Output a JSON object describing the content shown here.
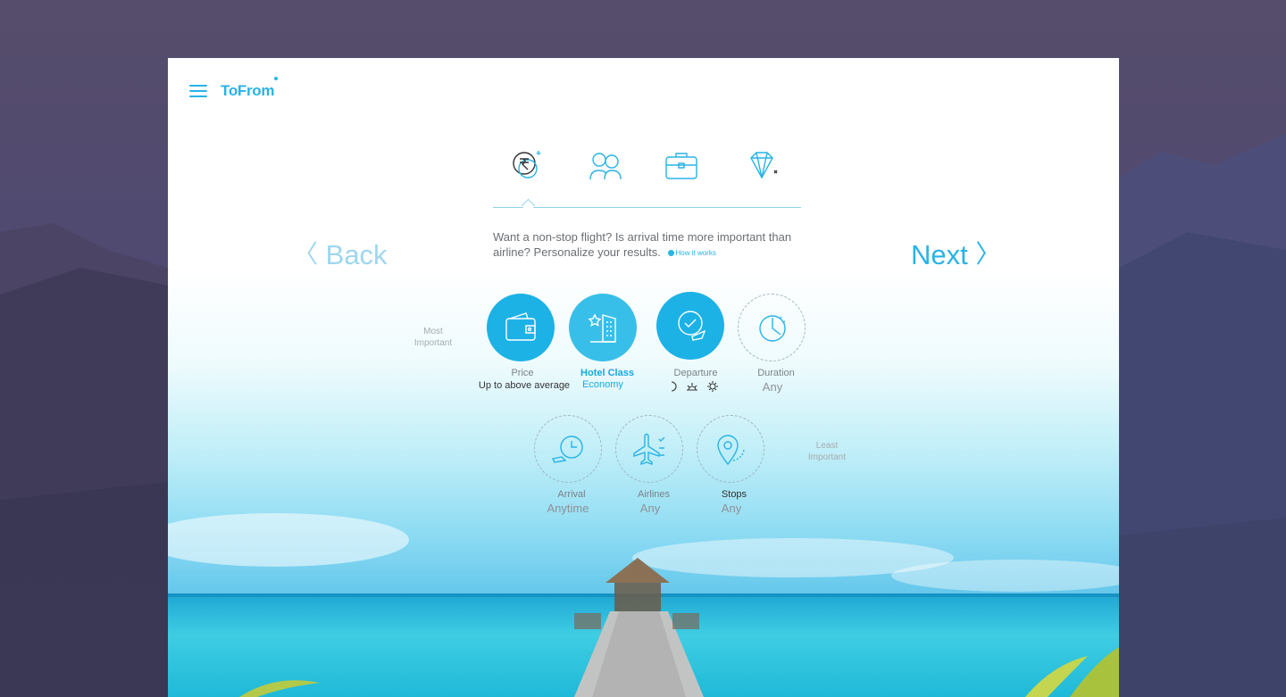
{
  "brand": {
    "name": "ToFrom",
    "accent": "#29b3e6"
  },
  "steps": [
    {
      "name": "budget-step",
      "icon": "rupee-coins-icon"
    },
    {
      "name": "travellers-step",
      "icon": "people-icon"
    },
    {
      "name": "trip-type-step",
      "icon": "briefcase-icon"
    },
    {
      "name": "luxury-step",
      "icon": "diamond-icon"
    }
  ],
  "nav": {
    "back_label": "Back",
    "next_label": "Next",
    "back_chevron": "〈",
    "next_chevron": "〉"
  },
  "intro": {
    "text": "Want a non-stop flight? Is arrival time more important than airline? Personalize your results.",
    "how_label": "How it works"
  },
  "rank": {
    "most": "Most\nImportant",
    "least": "Least\nImportant"
  },
  "preferences": [
    {
      "key": "price",
      "label": "Price",
      "value": "Up to  above average",
      "active": true
    },
    {
      "key": "hotel",
      "label": "Hotel Class",
      "value": "Economy",
      "active": true
    },
    {
      "key": "departure",
      "label": "Departure",
      "value": "",
      "active": true
    },
    {
      "key": "duration",
      "label": "Duration",
      "value": "Any",
      "active": false
    },
    {
      "key": "arrival",
      "label": "Arrival",
      "value": "Anytime",
      "active": false
    },
    {
      "key": "airlines",
      "label": "Airlines",
      "value": "Any",
      "active": false
    },
    {
      "key": "stops",
      "label": "Stops",
      "value": "Any",
      "active": false
    }
  ]
}
